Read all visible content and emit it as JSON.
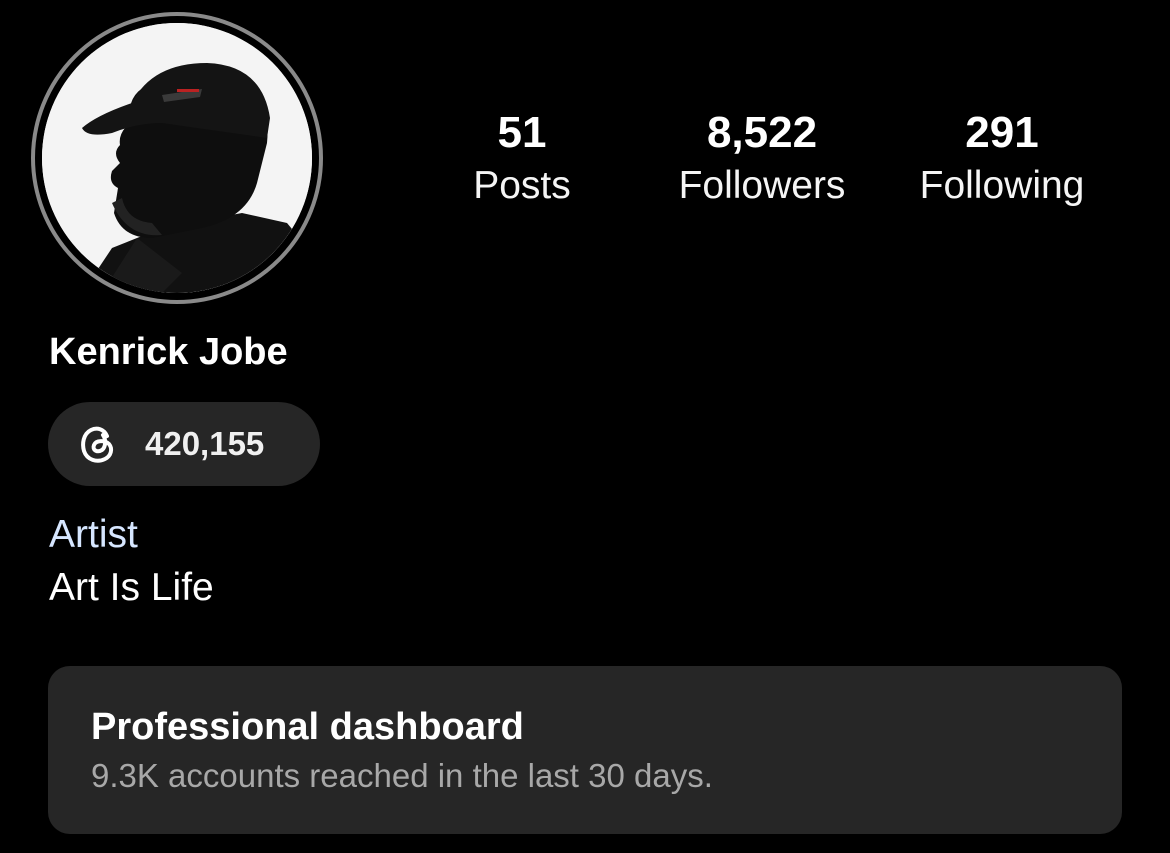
{
  "profile": {
    "display_name": "Kenrick Jobe",
    "avatar_icon": "profile-photo",
    "category": "Artist",
    "bio": "Art Is Life"
  },
  "stats": {
    "posts": {
      "count": "51",
      "label": "Posts"
    },
    "followers": {
      "count": "8,522",
      "label": "Followers"
    },
    "following": {
      "count": "291",
      "label": "Following"
    }
  },
  "threads": {
    "icon": "threads-icon",
    "count": "420,155"
  },
  "dashboard": {
    "title": "Professional dashboard",
    "subtitle": "9.3K accounts reached in the last 30 days."
  },
  "colors": {
    "background": "#000000",
    "card": "#262626",
    "category_text": "#d6e6ff",
    "secondary_text": "#a8a8a8"
  }
}
